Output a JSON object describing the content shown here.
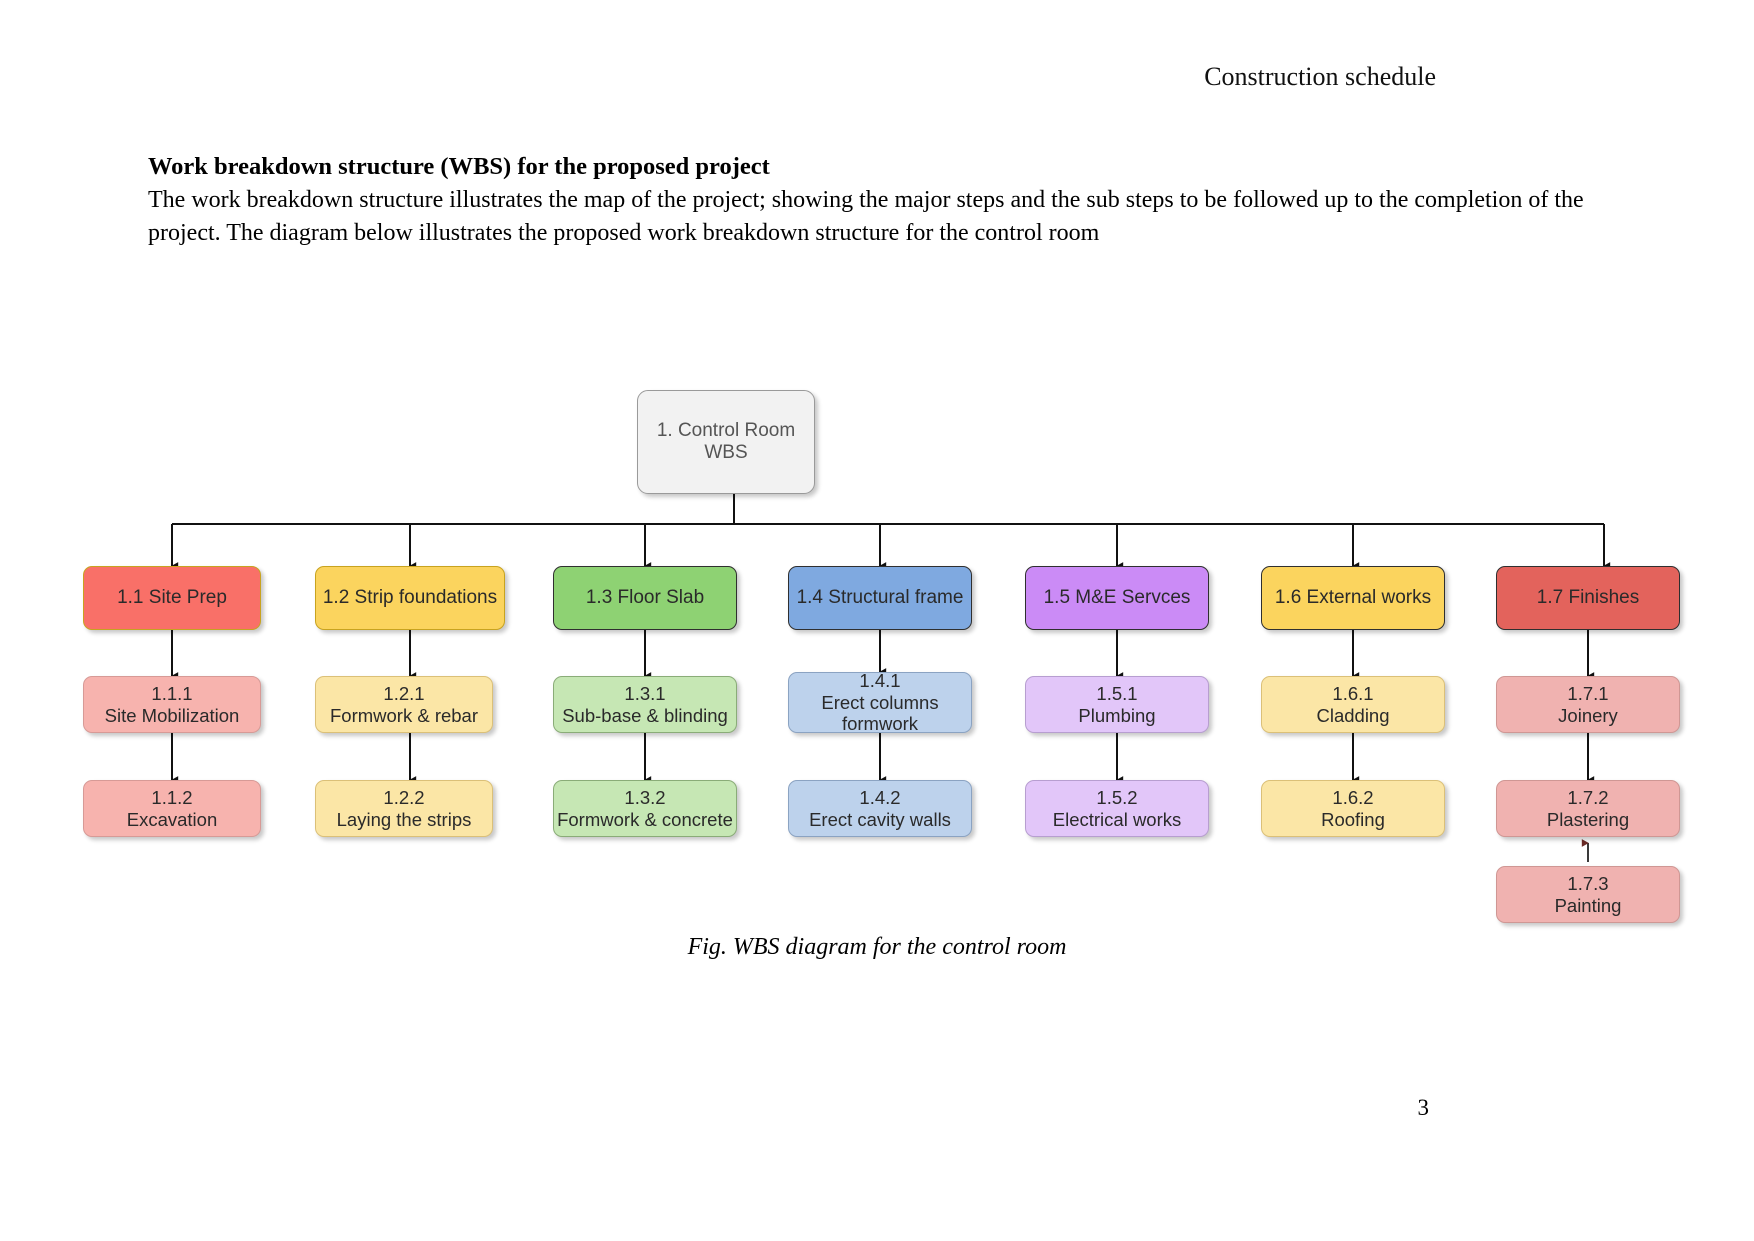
{
  "document": {
    "header_right": "Construction schedule",
    "section_title": "Work breakdown structure (WBS) for the proposed project",
    "paragraph": "The work breakdown structure illustrates the map of the project; showing the major steps and the sub steps to be followed up to the completion of the project. The diagram below illustrates the proposed work breakdown structure for the control room",
    "figure_caption": "Fig. WBS diagram for the control room",
    "page_number": "3"
  },
  "diagram": {
    "type": "work-breakdown-structure",
    "orientation": "top-down",
    "root": {
      "id": "1",
      "line1": "1. Control Room",
      "line2": "WBS",
      "fill": "#f2f2f2",
      "border": "#9a9a9a"
    },
    "branches": [
      {
        "id": "1.1",
        "label": "1.1 Site Prep",
        "fill": "#f97068",
        "border": "#c8a31f",
        "children": [
          {
            "id": "1.1.1",
            "line1": "1.1.1",
            "line2": "Site Mobilization",
            "fill": "#f7b3ae",
            "border": "#d79a96"
          },
          {
            "id": "1.1.2",
            "line1": "1.1.2",
            "line2": "Excavation",
            "fill": "#f7b3ae",
            "border": "#d79a96"
          }
        ]
      },
      {
        "id": "1.2",
        "label": "1.2 Strip foundations",
        "fill": "#fbd45e",
        "border": "#c8a31f",
        "children": [
          {
            "id": "1.2.1",
            "line1": "1.2.1",
            "line2": "Formwork & rebar",
            "fill": "#fbe6a6",
            "border": "#dbc078"
          },
          {
            "id": "1.2.2",
            "line1": "1.2.2",
            "line2": "Laying the strips",
            "fill": "#fbe6a6",
            "border": "#dbc078"
          }
        ]
      },
      {
        "id": "1.3",
        "label": "1.3 Floor Slab",
        "fill": "#8ed273",
        "border": "#2f2f2f",
        "children": [
          {
            "id": "1.3.1",
            "line1": "1.3.1",
            "line2": "Sub-base & blinding",
            "fill": "#c6e7b4",
            "border": "#8aac78"
          },
          {
            "id": "1.3.2",
            "line1": "1.3.2",
            "line2": "Formwork & concrete",
            "fill": "#c6e7b4",
            "border": "#8aac78"
          }
        ]
      },
      {
        "id": "1.4",
        "label": "1.4 Structural frame",
        "fill": "#7fa9e0",
        "border": "#2f2f2f",
        "children": [
          {
            "id": "1.4.1",
            "line1": "1.4.1",
            "line2": "Erect columns",
            "line3": "formwork",
            "fill": "#bdd2ec",
            "border": "#8ba3c2"
          },
          {
            "id": "1.4.2",
            "line1": "1.4.2",
            "line2": "Erect cavity walls",
            "fill": "#bdd2ec",
            "border": "#8ba3c2"
          }
        ]
      },
      {
        "id": "1.5",
        "label": "1.5 M&E Servces",
        "fill": "#cb8bf6",
        "border": "#2f2f2f",
        "children": [
          {
            "id": "1.5.1",
            "line1": "1.5.1",
            "line2": "Plumbing",
            "fill": "#e2c6f9",
            "border": "#b79ed0"
          },
          {
            "id": "1.5.2",
            "line1": "1.5.2",
            "line2": "Electrical works",
            "fill": "#e2c6f9",
            "border": "#b79ed0"
          }
        ]
      },
      {
        "id": "1.6",
        "label": "1.6 External works",
        "fill": "#fbd45e",
        "border": "#2f2f2f",
        "children": [
          {
            "id": "1.6.1",
            "line1": "1.6.1",
            "line2": "Cladding",
            "fill": "#fbe6a6",
            "border": "#dbc078"
          },
          {
            "id": "1.6.2",
            "line1": "1.6.2",
            "line2": "Roofing",
            "fill": "#fbe6a6",
            "border": "#dbc078"
          }
        ]
      },
      {
        "id": "1.7",
        "label": "1.7 Finishes",
        "fill": "#e3635c",
        "border": "#2f2f2f",
        "children": [
          {
            "id": "1.7.1",
            "line1": "1.7.1",
            "line2": "Joinery",
            "fill": "#f0b2b0",
            "border": "#cf9794"
          },
          {
            "id": "1.7.2",
            "line1": "1.7.2",
            "line2": "Plastering",
            "fill": "#f0b2b0",
            "border": "#cf9794"
          },
          {
            "id": "1.7.3",
            "line1": "1.7.3",
            "line2": "Painting",
            "fill": "#f0b2b0",
            "border": "#cf9794"
          }
        ]
      }
    ]
  }
}
